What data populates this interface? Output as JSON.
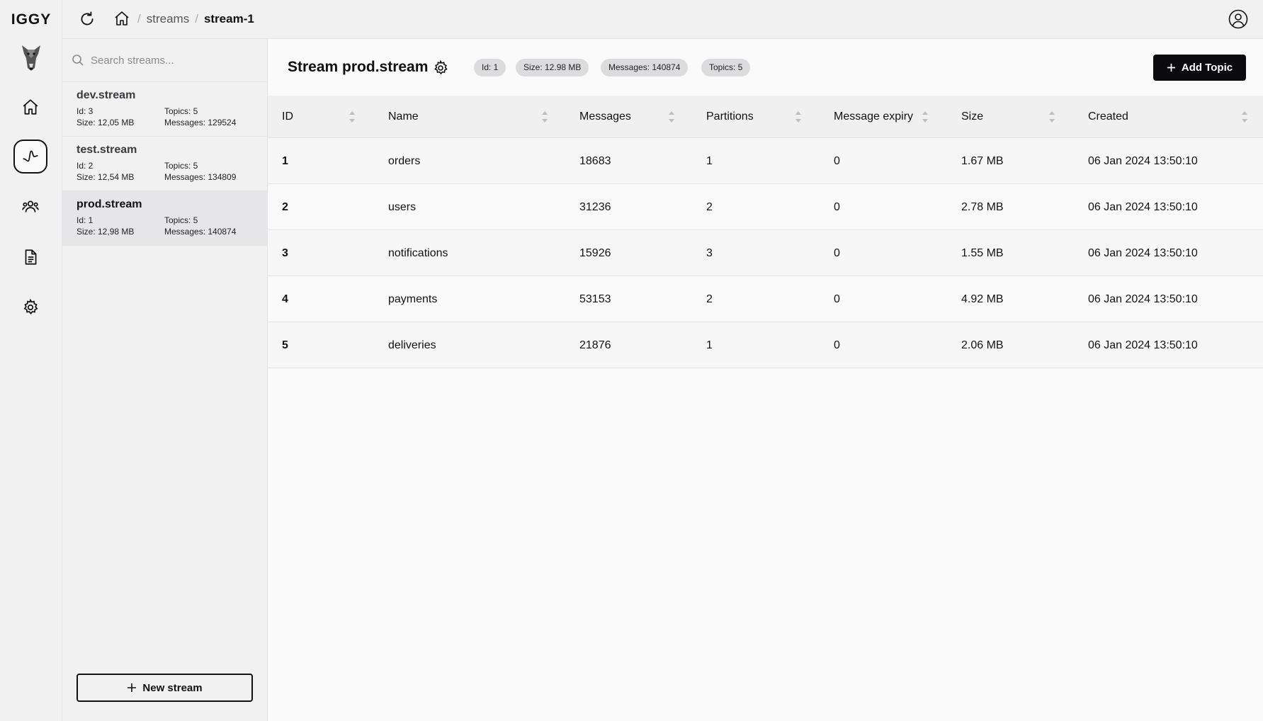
{
  "app": {
    "logo_text": "IGGY"
  },
  "breadcrumb": {
    "part1": "streams",
    "sep": "/",
    "current": "stream-1"
  },
  "search": {
    "placeholder": "Search streams..."
  },
  "streams": [
    {
      "name": "dev.stream",
      "id": "Id: 3",
      "topics": "Topics: 5",
      "size": "Size: 12,05 MB",
      "messages": "Messages: 129524"
    },
    {
      "name": "test.stream",
      "id": "Id: 2",
      "topics": "Topics: 5",
      "size": "Size: 12,54 MB",
      "messages": "Messages: 134809"
    },
    {
      "name": "prod.stream",
      "id": "Id: 1",
      "topics": "Topics: 5",
      "size": "Size: 12,98 MB",
      "messages": "Messages: 140874"
    }
  ],
  "new_stream_label": "New stream",
  "header": {
    "title": "Stream prod.stream",
    "badges": [
      "Id: 1",
      "Size: 12.98 MB",
      "Messages: 140874",
      "Topics: 5"
    ],
    "add_topic_label": "Add Topic"
  },
  "table": {
    "columns": [
      "ID",
      "Name",
      "Messages",
      "Partitions",
      "Message expiry",
      "Size",
      "Created"
    ],
    "rows": [
      [
        "1",
        "orders",
        "18683",
        "1",
        "0",
        "1.67 MB",
        "06 Jan 2024 13:50:10"
      ],
      [
        "2",
        "users",
        "31236",
        "2",
        "0",
        "2.78 MB",
        "06 Jan 2024 13:50:10"
      ],
      [
        "3",
        "notifications",
        "15926",
        "3",
        "0",
        "1.55 MB",
        "06 Jan 2024 13:50:10"
      ],
      [
        "4",
        "payments",
        "53153",
        "2",
        "0",
        "4.92 MB",
        "06 Jan 2024 13:50:10"
      ],
      [
        "5",
        "deliveries",
        "21876",
        "1",
        "0",
        "2.06 MB",
        "06 Jan 2024 13:50:10"
      ]
    ]
  },
  "icons": {
    "rail": [
      "home-icon",
      "streams-icon",
      "users-icon",
      "logs-icon",
      "settings-icon"
    ],
    "top": [
      "refresh-icon",
      "home-icon",
      "profile-icon"
    ]
  },
  "colors": {
    "primary_button": "#0b0b0d",
    "badge_bg": "#dcdcdf",
    "selected_item": "#e6e6e8"
  }
}
